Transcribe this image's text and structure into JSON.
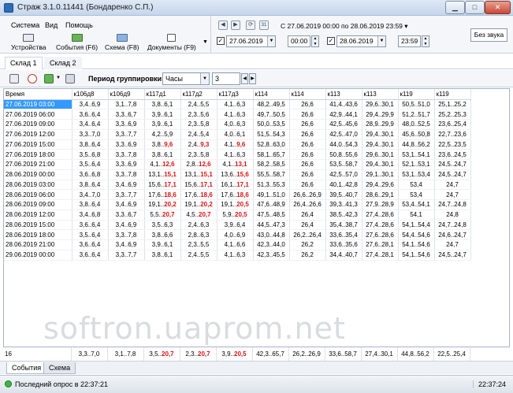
{
  "window": {
    "title": "Страж 3.1.0.11441 (Бондаренко С.П.)"
  },
  "menu": {
    "system": "Система",
    "view": "Вид",
    "help": "Помощь"
  },
  "toolbar": {
    "devices": "Устройства",
    "events": "События (F6)",
    "scheme": "Схема (F8)",
    "documents": "Документы (F9)"
  },
  "date_range": {
    "text": "С 27.06.2019 00:00 по 28.06.2019 23:59",
    "from_date": "27.06.2019",
    "from_time": "00:00",
    "to_date": "28.06.2019",
    "to_time": "23:59",
    "calendar_label": "31"
  },
  "mute_button": "Без звука",
  "tabs": [
    "Склад 1",
    "Склад 2"
  ],
  "grouping": {
    "label": "Период группировки",
    "value": "Часы",
    "count": "3"
  },
  "table": {
    "headers": [
      "Время",
      "к106д8",
      "к106д9",
      "к117д1",
      "к117д2",
      "к117д3",
      "к114",
      "к114",
      "к113",
      "к113",
      "к119",
      "к119"
    ],
    "rows": [
      [
        {
          "v": "27.06.2019 03:00"
        },
        {
          "v": "3,4..6,9"
        },
        {
          "v": "3,1..7,8"
        },
        {
          "v": "3,8..6,1"
        },
        {
          "v": "2,4..5,5"
        },
        {
          "v": "4,1..6,3"
        },
        {
          "v": "48,2..49,5"
        },
        {
          "v": "26,6"
        },
        {
          "v": "41,4..43,6"
        },
        {
          "v": "29,6..30,1"
        },
        {
          "v": "50,5..51,0"
        },
        {
          "v": "25,1..25,2"
        }
      ],
      [
        {
          "v": "27.06.2019 06:00"
        },
        {
          "v": "3,6..6,4"
        },
        {
          "v": "3,3..6,7"
        },
        {
          "v": "3,9..6,1"
        },
        {
          "v": "2,3..5,6"
        },
        {
          "v": "4,1..6,3"
        },
        {
          "v": "49,7..50,5"
        },
        {
          "v": "26,6"
        },
        {
          "v": "42,9..44,1"
        },
        {
          "v": "29,4..29,9"
        },
        {
          "v": "51,2..51,7"
        },
        {
          "v": "25,2..25,3"
        }
      ],
      [
        {
          "v": "27.06.2019 09:00"
        },
        {
          "v": "3,4..6,4"
        },
        {
          "v": "3,3..6,9"
        },
        {
          "v": "3,9..6,1"
        },
        {
          "v": "2,3..5,8"
        },
        {
          "v": "4,0..6,3"
        },
        {
          "v": "50,0..53,5"
        },
        {
          "v": "26,6"
        },
        {
          "v": "42,5..45,6"
        },
        {
          "v": "28,9..29,9"
        },
        {
          "v": "48,0..52,5"
        },
        {
          "v": "23,6..25,4"
        }
      ],
      [
        {
          "v": "27.06.2019 12:00"
        },
        {
          "v": "3,3..7,0"
        },
        {
          "v": "3,3..7,7"
        },
        {
          "v": "4,2..5,9"
        },
        {
          "v": "2,4..5,4"
        },
        {
          "v": "4,0..6,1"
        },
        {
          "v": "51,5..54,3"
        },
        {
          "v": "26,6"
        },
        {
          "v": "42,5..47,0"
        },
        {
          "v": "29,4..30,1"
        },
        {
          "v": "45,6..50,8"
        },
        {
          "v": "22,7..23,6"
        }
      ],
      [
        {
          "v": "27.06.2019 15:00"
        },
        {
          "v": "3,8..6,4"
        },
        {
          "v": "3,3..6,9"
        },
        {
          "v": "3,8..",
          "r": "9,6"
        },
        {
          "v": "2,4..",
          "r": "9,3"
        },
        {
          "v": "4,1..",
          "r": "9,6"
        },
        {
          "v": "52,8..63,0"
        },
        {
          "v": "26,6"
        },
        {
          "v": "44,0..54,3"
        },
        {
          "v": "29,4..30,1"
        },
        {
          "v": "44,8..56,2"
        },
        {
          "v": "22,5..23,5"
        }
      ],
      [
        {
          "v": "27.06.2019 18:00"
        },
        {
          "v": "3,5..6,8"
        },
        {
          "v": "3,3..7,8"
        },
        {
          "v": "3,8..6,1"
        },
        {
          "v": "2,3..5,8"
        },
        {
          "v": "4,1..6,3"
        },
        {
          "v": "58,1..65,7"
        },
        {
          "v": "26,6"
        },
        {
          "v": "50,8..55,6"
        },
        {
          "v": "29,6..30,1"
        },
        {
          "v": "53,1..54,1"
        },
        {
          "v": "23,6..24,5"
        }
      ],
      [
        {
          "v": "27.06.2019 21:00"
        },
        {
          "v": "3,5..6,4"
        },
        {
          "v": "3,3..6,9"
        },
        {
          "v": "4,1..",
          "r": "12,6"
        },
        {
          "v": "2,8..",
          "r": "12,6"
        },
        {
          "v": "4,1..",
          "r": "13,1"
        },
        {
          "v": "58,2..58,5"
        },
        {
          "v": "26,6"
        },
        {
          "v": "53,5..58,7"
        },
        {
          "v": "29,4..30,1"
        },
        {
          "v": "52,1..53,1"
        },
        {
          "v": "24,5..24,7"
        }
      ],
      [
        {
          "v": "28.06.2019 00:00"
        },
        {
          "v": "3,6..6,8"
        },
        {
          "v": "3,3..7,8"
        },
        {
          "v": "13,1..",
          "r": "15,1"
        },
        {
          "v": "13,1..",
          "r": "15,1"
        },
        {
          "v": "13,6..",
          "r": "15,6"
        },
        {
          "v": "55,5..58,7"
        },
        {
          "v": "26,6"
        },
        {
          "v": "42,5..57,0"
        },
        {
          "v": "29,1..30,1"
        },
        {
          "v": "53,1..53,4"
        },
        {
          "v": "24,5..24,7"
        }
      ],
      [
        {
          "v": "28.06.2019 03:00"
        },
        {
          "v": "3,8..6,4"
        },
        {
          "v": "3,4..6,9"
        },
        {
          "v": "15,6..",
          "r": "17,1"
        },
        {
          "v": "15,6..",
          "r": "17,1"
        },
        {
          "v": "16,1..",
          "r": "17,1"
        },
        {
          "v": "51,3..55,3"
        },
        {
          "v": "26,6"
        },
        {
          "v": "40,1..42,8"
        },
        {
          "v": "29,4..29,6"
        },
        {
          "v": "53,4"
        },
        {
          "v": "24,7"
        }
      ],
      [
        {
          "v": "28.06.2019 06:00"
        },
        {
          "v": "3,4..7,0"
        },
        {
          "v": "3,3..7,7"
        },
        {
          "v": "17,6..",
          "r": "18,6"
        },
        {
          "v": "17,6..",
          "r": "18,6"
        },
        {
          "v": "17,6..",
          "r": "18,6"
        },
        {
          "v": "49,1..51,0"
        },
        {
          "v": "26,6..26,9"
        },
        {
          "v": "39,5..40,7"
        },
        {
          "v": "28,6..29,1"
        },
        {
          "v": "53,4"
        },
        {
          "v": "24,7"
        }
      ],
      [
        {
          "v": "28.06.2019 09:00"
        },
        {
          "v": "3,8..6,4"
        },
        {
          "v": "3,4..6,9"
        },
        {
          "v": "19,1..",
          "r": "20,2"
        },
        {
          "v": "19,1..",
          "r": "20,2"
        },
        {
          "v": "19,1..",
          "r": "20,5"
        },
        {
          "v": "47,6..48,9"
        },
        {
          "v": "26,4..26,6"
        },
        {
          "v": "39,3..41,3"
        },
        {
          "v": "27,9..28,9"
        },
        {
          "v": "53,4..54,1"
        },
        {
          "v": "24,7..24,8"
        }
      ],
      [
        {
          "v": "28.06.2019 12:00"
        },
        {
          "v": "3,4..6,8"
        },
        {
          "v": "3,3..6,7"
        },
        {
          "v": "5,5..",
          "r": "20,7"
        },
        {
          "v": "4,5..",
          "r": "20,7"
        },
        {
          "v": "5,9..",
          "r": "20,5"
        },
        {
          "v": "47,5..48,5"
        },
        {
          "v": "26,4"
        },
        {
          "v": "38,5..42,3"
        },
        {
          "v": "27,4..28,6"
        },
        {
          "v": "54,1"
        },
        {
          "v": "24,8"
        }
      ],
      [
        {
          "v": "28.06.2019 15:00"
        },
        {
          "v": "3,6..6,4"
        },
        {
          "v": "3,4..6,9"
        },
        {
          "v": "3,5..6,3"
        },
        {
          "v": "2,4..6,3"
        },
        {
          "v": "3,9..6,4"
        },
        {
          "v": "44,5..47,3"
        },
        {
          "v": "26,4"
        },
        {
          "v": "35,4..38,7"
        },
        {
          "v": "27,4..28,6"
        },
        {
          "v": "54,1..54,4"
        },
        {
          "v": "24,7..24,8"
        }
      ],
      [
        {
          "v": "28.06.2019 18:00"
        },
        {
          "v": "3,5..6,4"
        },
        {
          "v": "3,3..7,8"
        },
        {
          "v": "3,8..6,6"
        },
        {
          "v": "2,8..6,3"
        },
        {
          "v": "4,0..6,9"
        },
        {
          "v": "43,0..44,8"
        },
        {
          "v": "26,2..26,4"
        },
        {
          "v": "33,6..35,4"
        },
        {
          "v": "27,6..28,6"
        },
        {
          "v": "54,4..54,6"
        },
        {
          "v": "24,6..24,7"
        }
      ],
      [
        {
          "v": "28.06.2019 21:00"
        },
        {
          "v": "3,6..6,4"
        },
        {
          "v": "3,4..6,9"
        },
        {
          "v": "3,9..6,1"
        },
        {
          "v": "2,3..5,5"
        },
        {
          "v": "4,1..6,6"
        },
        {
          "v": "42,3..44,0"
        },
        {
          "v": "26,2"
        },
        {
          "v": "33,6..35,6"
        },
        {
          "v": "27,6..28,1"
        },
        {
          "v": "54,1..54,6"
        },
        {
          "v": "24,7"
        }
      ],
      [
        {
          "v": "29.06.2019 00:00"
        },
        {
          "v": "3,6..6,4"
        },
        {
          "v": "3,3..7,7"
        },
        {
          "v": "3,8..6,1"
        },
        {
          "v": "2,4..5,5"
        },
        {
          "v": "4,1..6,3"
        },
        {
          "v": "42,3..45,5"
        },
        {
          "v": "26,2"
        },
        {
          "v": "34,4..40,7"
        },
        {
          "v": "27,4..28,1"
        },
        {
          "v": "54,1..54,6"
        },
        {
          "v": "24,5..24,7"
        }
      ]
    ],
    "footer": [
      {
        "v": "16"
      },
      {
        "v": "3,3..7,0"
      },
      {
        "v": "3,1..7,8"
      },
      {
        "v": "3,5..",
        "r": "20,7"
      },
      {
        "v": "2,3..",
        "r": "20,7"
      },
      {
        "v": "3,9..",
        "r": "20,5"
      },
      {
        "v": "42,3..65,7"
      },
      {
        "v": "26,2..26,9"
      },
      {
        "v": "33,6..58,7"
      },
      {
        "v": "27,4..30,1"
      },
      {
        "v": "44,8..56,2"
      },
      {
        "v": "22,5..25,4"
      }
    ],
    "selected_row": 0
  },
  "watermark": "softron.uaprom.net",
  "bottom_tabs": [
    "События",
    "Схема"
  ],
  "status": {
    "text": "Последний опрос в 22:37:21",
    "time": "22:37:24"
  },
  "colors": {
    "alert": "#dd1111",
    "selection": "#3399ff",
    "status_ok": "#3db543"
  }
}
